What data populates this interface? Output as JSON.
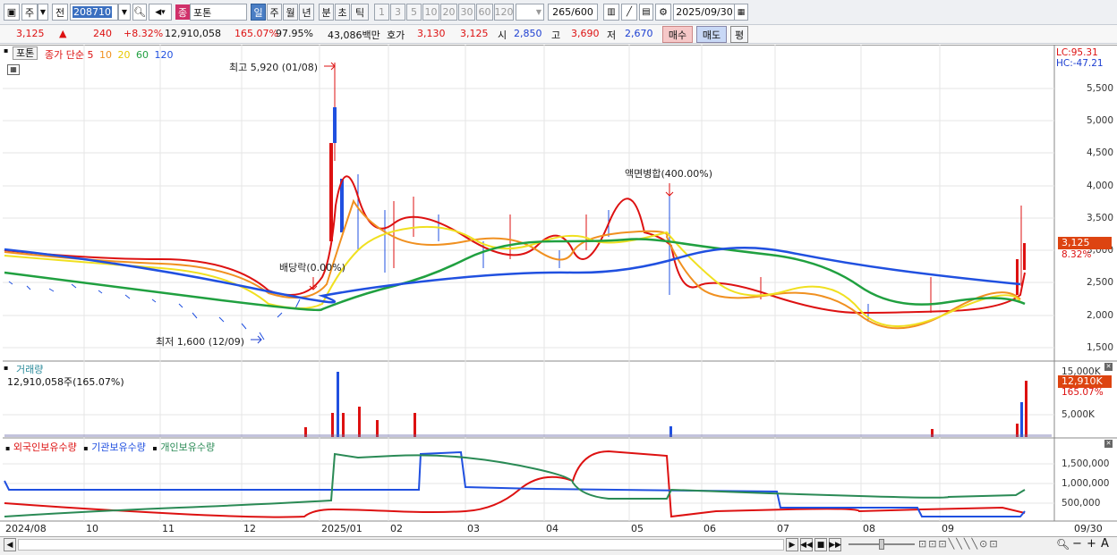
{
  "toolbar": {
    "market": "주",
    "scope": "전",
    "code": "208710",
    "badge": "종",
    "name": "포톤",
    "periods": [
      "일",
      "주",
      "월",
      "년",
      "분",
      "초",
      "틱"
    ],
    "active_period": "일",
    "presets": [
      "1",
      "3",
      "5",
      "10",
      "20",
      "30",
      "60",
      "120"
    ],
    "count": "265",
    "count_total": "/600",
    "date": "2025/09/30"
  },
  "quote": {
    "price": "3,125",
    "arrow": "▲",
    "change": "240",
    "change_pct": "+8.32%",
    "volume": "12,910,058",
    "volume_ratio": "165.07%",
    "strength": "97.95%",
    "amount": "43,086백만",
    "bid_label": "호가",
    "ask": "3,130",
    "bid": "3,125",
    "open_label": "시",
    "open": "2,850",
    "high_label": "고",
    "high": "3,690",
    "low_label": "저",
    "low": "2,670",
    "buy_label": "매수",
    "sell_label": "매도",
    "eval_label": "평"
  },
  "price_panel": {
    "stock_label": "포톤",
    "ma_title": "종가 단순",
    "ma_periods": [
      "5",
      "10",
      "20",
      "60",
      "120"
    ],
    "ma_colors": [
      "#e02020",
      "#f09020",
      "#f0e020",
      "#20a040",
      "#2050e0"
    ],
    "lc": "LC:95.31",
    "hc": "HC:-47.21",
    "y_ticks": [
      "5,500",
      "5,000",
      "4,500",
      "4,000",
      "3,500",
      "3,000",
      "2,500",
      "2,000",
      "1,500"
    ],
    "current_tag": "3,125",
    "current_pct": "8.32%",
    "annotations": {
      "high": "최고 5,920 (01/08)",
      "low": "최저 1,600 (12/09)",
      "dividend": "배당락(0.00%)",
      "split": "액면병합(400.00%)"
    }
  },
  "volume_panel": {
    "title": "거래량",
    "value": "12,910,058주(165.07%)",
    "y_ticks": [
      "15,000K",
      "5,000K"
    ],
    "current_tag": "12,910K",
    "current_pct": "165.07%"
  },
  "holdings_panel": {
    "legend": [
      "외국인보유수량",
      "기관보유수량",
      "개인보유수량"
    ],
    "legend_colors": [
      "#d11",
      "#2050e0",
      "#2a8a55"
    ],
    "y_ticks": [
      "1,500,000",
      "1,000,000",
      "500,000"
    ]
  },
  "x_axis": {
    "labels": [
      "2024/08",
      "10",
      "11",
      "12",
      "2025/01",
      "02",
      "03",
      "04",
      "05",
      "06",
      "07",
      "08",
      "09"
    ],
    "right_label": "09/30"
  }
}
